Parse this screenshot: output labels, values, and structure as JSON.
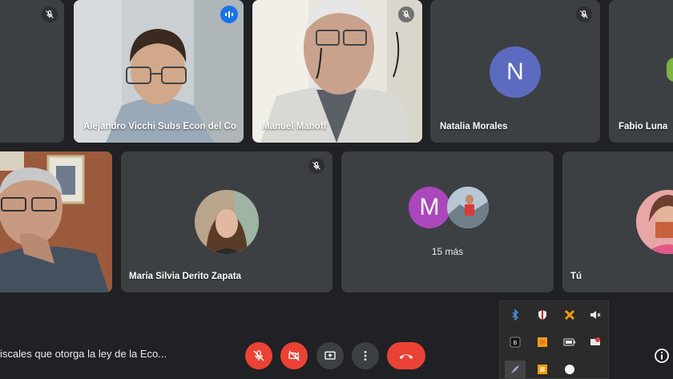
{
  "participants": [
    {
      "name": "",
      "muted": true
    },
    {
      "name": "Alejandro Vicchi Subs Econ del Co",
      "speaking": true
    },
    {
      "name": "Manuel Manoff",
      "muted": true
    },
    {
      "name": "Natalia Morales",
      "initial": "N",
      "avatar_color": "#5c6bc0",
      "muted": true
    },
    {
      "name": "Fabio Luna"
    },
    {
      "name": ""
    },
    {
      "name": "Maria Silvia Derito Zapata",
      "muted": true
    },
    {
      "name": "",
      "more_initial": "M",
      "more_color": "#ab47bc",
      "more_label": "15 más"
    },
    {
      "name": "Tú"
    }
  ],
  "caption": "iscales que otorga la ley de la Eco...",
  "controls": {
    "mic": "microphone-off",
    "camera": "camera-off",
    "present": "present-screen",
    "more": "more-options",
    "end": "end-call"
  },
  "tray_icons": [
    "bluetooth-icon",
    "shield-icon",
    "security-icon",
    "volume-muted-icon",
    "app-icon",
    "update-icon",
    "battery-icon",
    "settings-icon",
    "pen-icon",
    "office-icon",
    "circle-icon"
  ]
}
